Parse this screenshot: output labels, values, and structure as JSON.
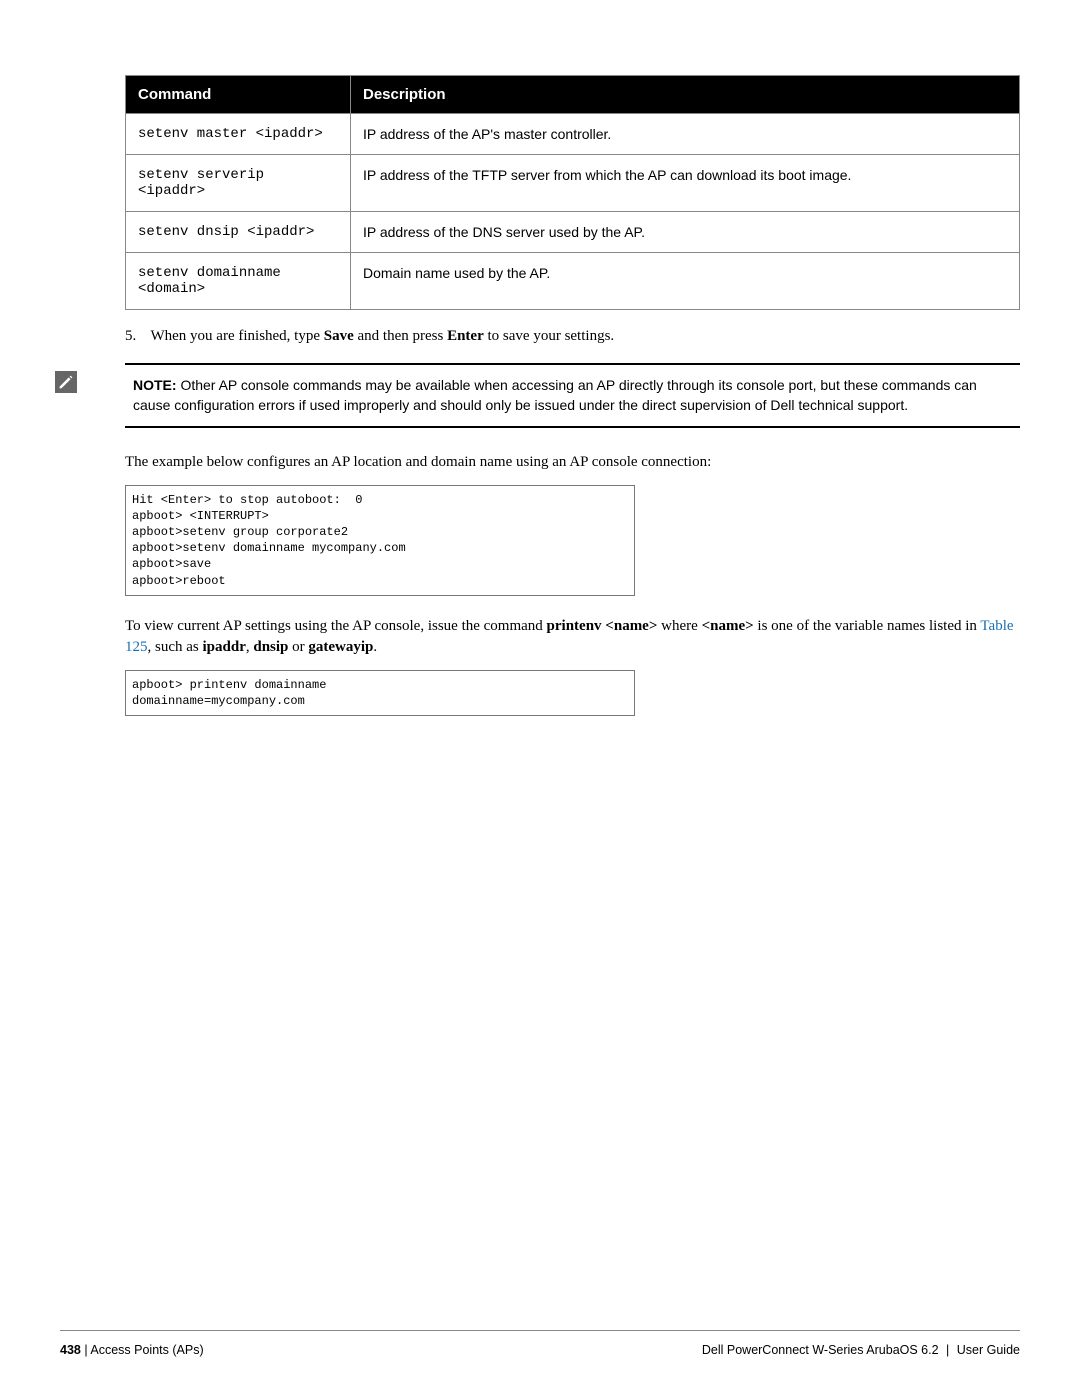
{
  "table": {
    "headers": {
      "command": "Command",
      "description": "Description"
    },
    "rows": [
      {
        "cmd": "setenv master <ipaddr>",
        "desc": "IP address of the AP's master controller."
      },
      {
        "cmd": "setenv serverip <ipaddr>",
        "desc": "IP address of the TFTP server from which the AP can download its boot image."
      },
      {
        "cmd": "setenv dnsip <ipaddr>",
        "desc": "IP address of the DNS server used by the AP."
      },
      {
        "cmd": "setenv domainname <domain>",
        "desc": "Domain name used by the AP."
      }
    ]
  },
  "step": {
    "number": "5.",
    "pre": "When you are finished, type ",
    "save": "Save",
    "mid": " and then press ",
    "enter": "Enter",
    "post": " to save your settings."
  },
  "note": {
    "label": "NOTE:",
    "text": " Other AP console commands may be available when accessing an AP directly through its console port, but these commands can cause configuration errors if used improperly and should only be issued under the direct supervision of Dell technical support."
  },
  "para1": "The example below configures an AP location and domain name using an AP console connection:",
  "code1": "Hit <Enter> to stop autoboot:  0\napboot> <INTERRUPT>\napboot>setenv group corporate2\napboot>setenv domainname mycompany.com\napboot>save\napboot>reboot",
  "para2": {
    "pre": "To view current AP settings using the AP console, issue the command ",
    "cmd1": "printenv <name>",
    "mid1": " where ",
    "cmd2": "<name>",
    "mid2": " is one of the variable names listed in ",
    "link": "Table 125",
    "post1": ", such as ",
    "v1": "ipaddr",
    "c1": ", ",
    "v2": "dnsip",
    "c2": " or ",
    "v3": "gatewayip",
    "end": "."
  },
  "code2": "apboot> printenv domainname\ndomainname=mycompany.com",
  "footer": {
    "page": "438",
    "sep": " | ",
    "section": "Access Points (APs)",
    "product": "Dell PowerConnect W-Series ArubaOS 6.2",
    "doc": "User Guide"
  }
}
